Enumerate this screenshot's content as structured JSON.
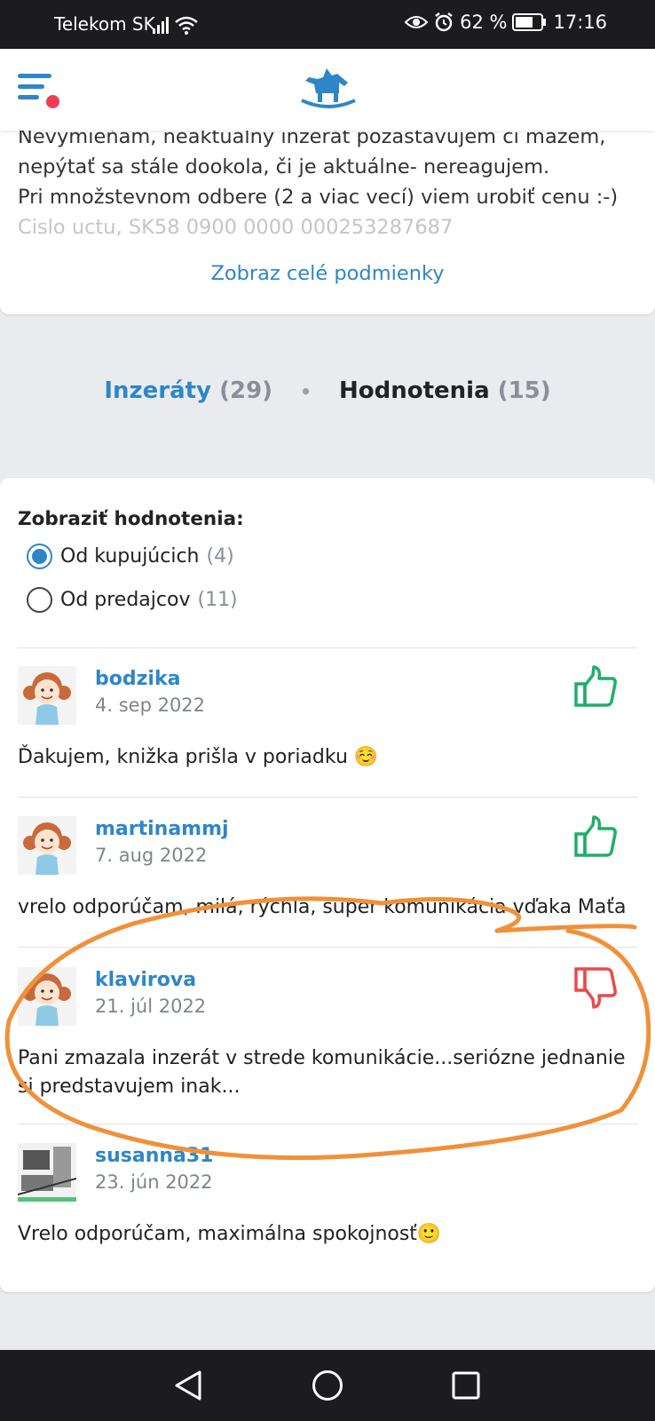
{
  "status_bar": {
    "carrier": "Telekom SK",
    "battery": "62 %",
    "time": "17:16"
  },
  "conditions": {
    "lines": [
      "Nevymieňam, neaktuálny inzerát pozastavujem či mažem,",
      "nepýtať sa stále dookola, či je aktuálne- nereagujem.",
      "Pri množstevnom odbere (2 a viac vecí) viem urobiť cenu :-)"
    ],
    "faded_line": "Cislo uctu, SK58 0900 0000 000253287687",
    "show_all_link": "Zobraz celé podmienky"
  },
  "tabs": {
    "ads_label": "Inzeráty",
    "ads_count": "(29)",
    "separator": "•",
    "reviews_label": "Hodnotenia",
    "reviews_count": "(15)"
  },
  "reviews_filter": {
    "title": "Zobraziť hodnotenia:",
    "options": [
      {
        "label": "Od kupujúcich",
        "count": "(4)",
        "selected": true
      },
      {
        "label": "Od predajcov",
        "count": "(11)",
        "selected": false
      }
    ]
  },
  "reviews": [
    {
      "user": "bodzika",
      "date": "4. sep 2022",
      "rating": "positive",
      "text": "Ďakujem, knižka prišla v poriadku ☺️"
    },
    {
      "user": "martinammj",
      "date": "7. aug 2022",
      "rating": "positive",
      "text": "vrelo odporúčam, milá, rýchla, super komunikácia vďaka Maťa"
    },
    {
      "user": "klavirova",
      "date": "21. júl 2022",
      "rating": "negative",
      "text": "Pani zmazala inzerát v strede komunikácie...seriózne jednanie si predstavujem inak..."
    },
    {
      "user": "susanna31",
      "date": "23. jún 2022",
      "rating": "none",
      "text": "Vrelo odporúčam, maximálna spokojnosť🙂"
    }
  ],
  "colors": {
    "accent": "#2e86c8",
    "positive": "#1fae6b",
    "negative": "#e84b4b",
    "annotation": "#f0913a",
    "notification_dot": "#ee3a54"
  },
  "icons": {
    "menu": "hamburger-menu-icon",
    "logo": "rocking-horse-logo",
    "positive": "thumbs-up-icon",
    "negative": "thumbs-down-icon",
    "nav_back": "triangle-back-icon",
    "nav_home": "circle-home-icon",
    "nav_recents": "square-recents-icon"
  }
}
